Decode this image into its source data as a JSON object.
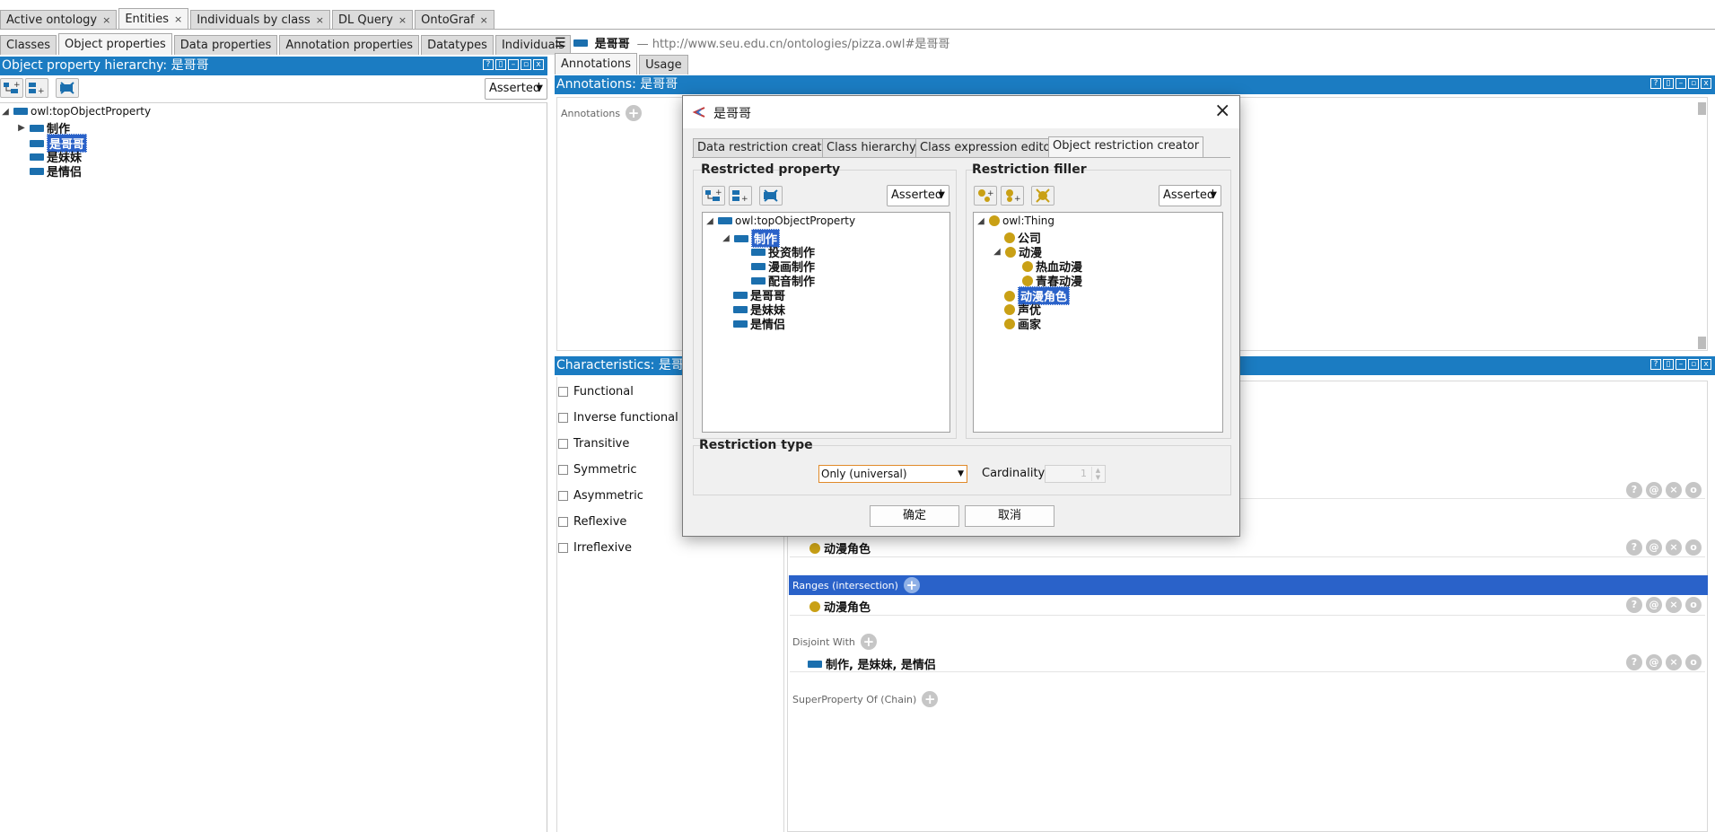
{
  "top_tabs": [
    {
      "label": "Active ontology",
      "closable": true
    },
    {
      "label": "Entities",
      "closable": true,
      "active": true
    },
    {
      "label": "Individuals by class",
      "closable": true
    },
    {
      "label": "DL Query",
      "closable": true
    },
    {
      "label": "OntoGraf",
      "closable": true
    }
  ],
  "close_glyph": "×",
  "entity_tabs": [
    "Classes",
    "Object properties",
    "Data properties",
    "Annotation properties",
    "Datatypes",
    "Individuals"
  ],
  "hierarchy": {
    "title": "Object property hierarchy: 是哥哥",
    "mode": "Asserted",
    "root": "owl:topObjectProperty",
    "children": [
      "制作",
      "是哥哥",
      "是妹妹",
      "是情侣"
    ]
  },
  "entity_header": {
    "name": "是哥哥",
    "iri": "— http://www.seu.edu.cn/ontologies/pizza.owl#是哥哥"
  },
  "right_tabs": [
    "Annotations",
    "Usage"
  ],
  "annotations": {
    "title": "Annotations: 是哥哥",
    "label": "Annotations"
  },
  "characteristics": {
    "title": "Characteristics: 是哥哥",
    "items": [
      "Functional",
      "Inverse functional",
      "Transitive",
      "Symmetric",
      "Asymmetric",
      "Reflexive",
      "Irreflexive"
    ]
  },
  "description": {
    "domain_value": "动漫角色",
    "ranges_label": "Ranges (intersection)",
    "range_value": "动漫角色",
    "disjoint_label": "Disjoint With",
    "disjoint_value": "制作, 是妹妹, 是情侣",
    "superproperty_label": "SuperProperty Of (Chain)"
  },
  "round_buttons": [
    "?",
    "@",
    "×",
    "o"
  ],
  "dialog": {
    "title": "是哥哥",
    "close": "×",
    "tabs": [
      "Data restriction creator",
      "Class hierarchy",
      "Class expression editor",
      "Object restriction creator"
    ],
    "restricted_property": {
      "title": "Restricted property",
      "mode": "Asserted",
      "root": "owl:topObjectProperty",
      "selected": "制作",
      "sub_of_selected": [
        "投资制作",
        "漫画制作",
        "配音制作"
      ],
      "others": [
        "是哥哥",
        "是妹妹",
        "是情侣"
      ]
    },
    "restriction_filler": {
      "title": "Restriction filler",
      "mode": "Asserted",
      "root": "owl:Thing",
      "items": [
        "公司",
        "动漫"
      ],
      "anime_children": [
        "热血动漫",
        "青春动漫"
      ],
      "selected": "动漫角色",
      "rest": [
        "声优",
        "画家"
      ]
    },
    "restriction_type": {
      "title": "Restriction type",
      "selected": "Only (universal)",
      "cardinality_label": "Cardinality",
      "cardinality_value": "1"
    },
    "ok_label": "确定",
    "cancel_label": "取消"
  },
  "colors": {
    "accent": "#1b7cc2",
    "selection": "#2a62c9",
    "class_icon": "#c9a015",
    "property_icon": "#1b6fae"
  }
}
